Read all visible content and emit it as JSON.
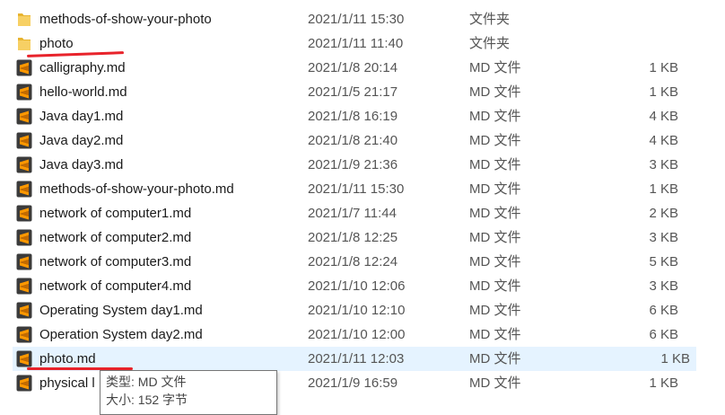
{
  "files": [
    {
      "name": "methods-of-show-your-photo",
      "date": "2021/1/11 15:30",
      "type": "文件夹",
      "size": "",
      "icon": "folder-icon"
    },
    {
      "name": "photo",
      "date": "2021/1/11 11:40",
      "type": "文件夹",
      "size": "",
      "icon": "folder-icon"
    },
    {
      "name": "calligraphy.md",
      "date": "2021/1/8 20:14",
      "type": "MD 文件",
      "size": "1 KB",
      "icon": "sublime-file-icon"
    },
    {
      "name": "hello-world.md",
      "date": "2021/1/5 21:17",
      "type": "MD 文件",
      "size": "1 KB",
      "icon": "sublime-file-icon"
    },
    {
      "name": "Java day1.md",
      "date": "2021/1/8 16:19",
      "type": "MD 文件",
      "size": "4 KB",
      "icon": "sublime-file-icon"
    },
    {
      "name": "Java day2.md",
      "date": "2021/1/8 21:40",
      "type": "MD 文件",
      "size": "4 KB",
      "icon": "sublime-file-icon"
    },
    {
      "name": "Java day3.md",
      "date": "2021/1/9 21:36",
      "type": "MD 文件",
      "size": "3 KB",
      "icon": "sublime-file-icon"
    },
    {
      "name": "methods-of-show-your-photo.md",
      "date": "2021/1/11 15:30",
      "type": "MD 文件",
      "size": "1 KB",
      "icon": "sublime-file-icon"
    },
    {
      "name": "network of computer1.md",
      "date": "2021/1/7 11:44",
      "type": "MD 文件",
      "size": "2 KB",
      "icon": "sublime-file-icon"
    },
    {
      "name": "network of computer2.md",
      "date": "2021/1/8 12:25",
      "type": "MD 文件",
      "size": "3 KB",
      "icon": "sublime-file-icon"
    },
    {
      "name": "network of computer3.md",
      "date": "2021/1/8 12:24",
      "type": "MD 文件",
      "size": "5 KB",
      "icon": "sublime-file-icon"
    },
    {
      "name": "network of computer4.md",
      "date": "2021/1/10 12:06",
      "type": "MD 文件",
      "size": "3 KB",
      "icon": "sublime-file-icon"
    },
    {
      "name": "Operating System day1.md",
      "date": "2021/1/10 12:10",
      "type": "MD 文件",
      "size": "6 KB",
      "icon": "sublime-file-icon"
    },
    {
      "name": "Operation System day2.md",
      "date": "2021/1/10 12:00",
      "type": "MD 文件",
      "size": "6 KB",
      "icon": "sublime-file-icon"
    },
    {
      "name": "photo.md",
      "date": "2021/1/11 12:03",
      "type": "MD 文件",
      "size": "1 KB",
      "icon": "sublime-file-icon"
    },
    {
      "name": "physical l",
      "date": "2021/1/9 16:59",
      "type": "MD 文件",
      "size": "1 KB",
      "icon": "sublime-file-icon"
    }
  ],
  "tooltip": {
    "type_line": "类型: MD 文件",
    "size_line": "大小: 152 字节"
  },
  "colors": {
    "folder": "#f0c048",
    "sublime_bg": "#3b3b3b",
    "sublime_s": "#ff9800",
    "annotation_red": "#e8232b",
    "hover_row": "#e5f3ff"
  }
}
